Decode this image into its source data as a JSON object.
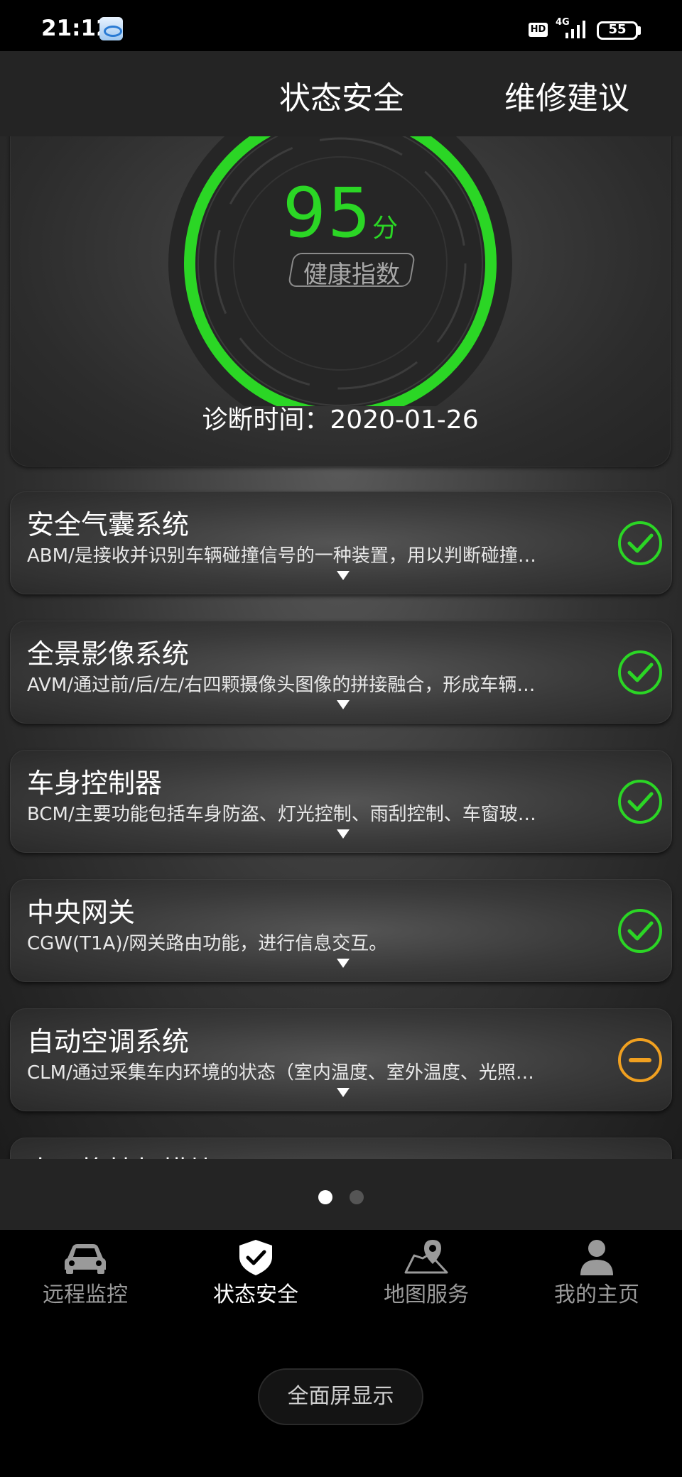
{
  "status_bar": {
    "time": "21:12",
    "hd_label": "HD",
    "network_label": "4G",
    "battery": "55"
  },
  "header": {
    "tabs": [
      {
        "label": "状态安全",
        "active": true
      },
      {
        "label": "维修建议",
        "active": false
      }
    ]
  },
  "score": {
    "value": "95",
    "unit": "分",
    "label": "健康指数",
    "progress_fraction": 0.95,
    "diagnosis_time": "诊断时间：2020-01-26"
  },
  "systems": [
    {
      "title": "安全气囊系统",
      "desc": "ABM/是接收并识别车辆碰撞信号的一种装置，用以判断碰撞…",
      "status": "ok"
    },
    {
      "title": "全景影像系统",
      "desc": "AVM/通过前/后/左/右四颗摄像头图像的拼接融合，形成车辆…",
      "status": "ok"
    },
    {
      "title": "车身控制器",
      "desc": "BCM/主要功能包括车身防盗、灯光控制、雨刮控制、车窗玻…",
      "status": "ok"
    },
    {
      "title": "中央网关",
      "desc": "CGW(T1A)/网关路由功能，进行信息交互。",
      "status": "ok"
    },
    {
      "title": "自动空调系统",
      "desc": "CLM/通过采集车内环境的状态（室内温度、室外温度、光照…",
      "status": "warning"
    },
    {
      "title": "电子换挡杆模块",
      "desc": "",
      "status": "ok"
    }
  ],
  "colors": {
    "ok": "#2bd625",
    "warning": "#f0a020",
    "accent_green": "#2bd625"
  },
  "pager": {
    "pages": 2,
    "current": 1
  },
  "bottom_nav": [
    {
      "label": "远程监控",
      "icon": "car-icon",
      "active": false
    },
    {
      "label": "状态安全",
      "icon": "shield-check-icon",
      "active": true
    },
    {
      "label": "地图服务",
      "icon": "map-pin-icon",
      "active": false
    },
    {
      "label": "我的主页",
      "icon": "person-icon",
      "active": false
    }
  ],
  "fullscreen_button": {
    "label": "全面屏显示"
  }
}
